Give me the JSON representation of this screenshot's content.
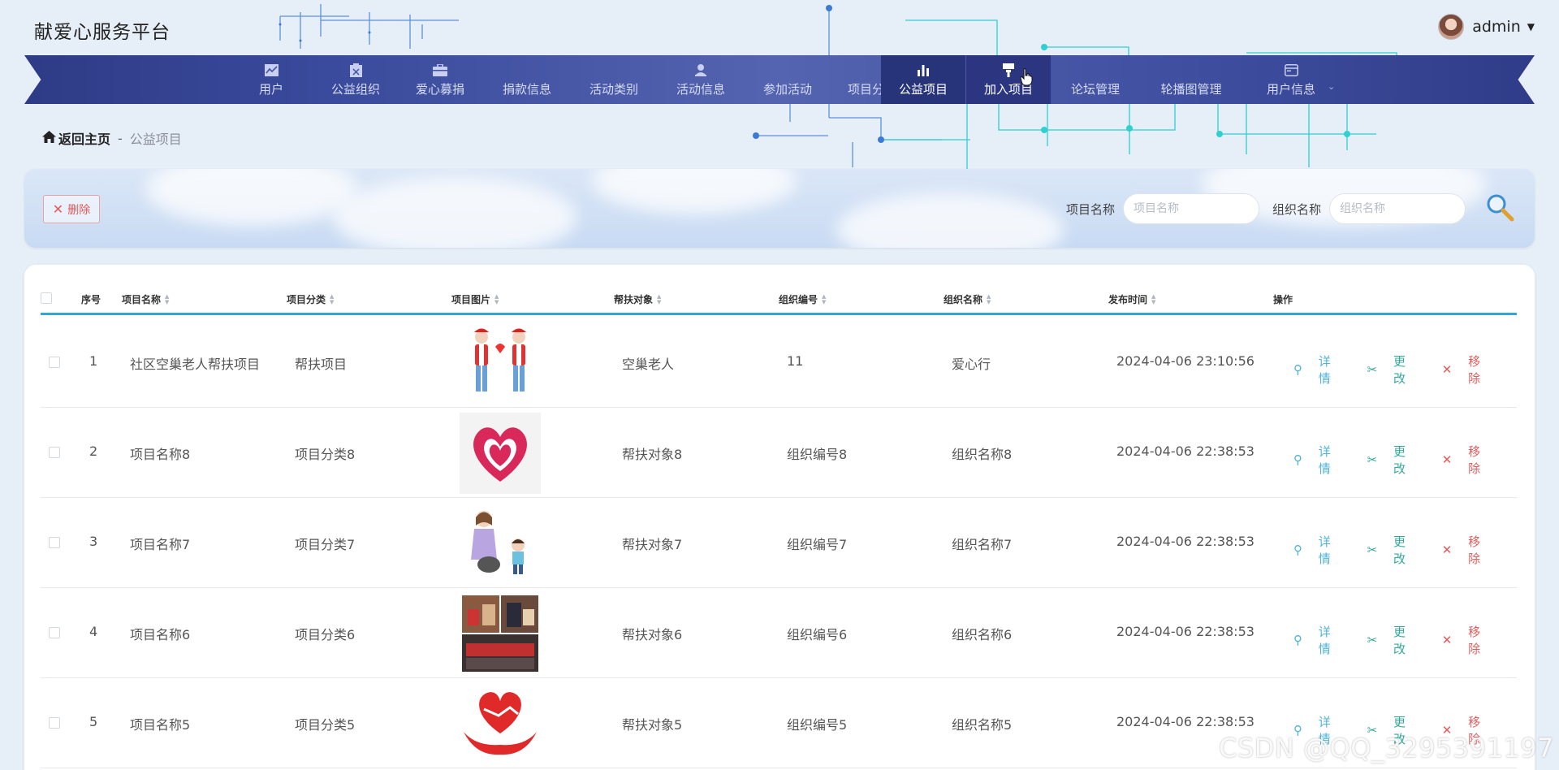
{
  "app": {
    "title": "献爱心服务平台"
  },
  "user": {
    "name": "admin"
  },
  "nav": [
    {
      "label": "用户",
      "icon": "chart-icon"
    },
    {
      "label": "公益组织",
      "icon": "clipboard-icon"
    },
    {
      "label": "爱心募捐",
      "icon": "briefcase-icon"
    },
    {
      "label": "捐款信息",
      "icon": "grid-icon"
    },
    {
      "label": "活动类别",
      "icon": "grid9-icon"
    },
    {
      "label": "活动信息",
      "icon": "person-icon"
    },
    {
      "label": "参加活动",
      "icon": "grid-icon"
    },
    {
      "label": "项目分类",
      "icon": "grid-icon"
    },
    {
      "label": "公益项目",
      "icon": "bar-chart-icon"
    },
    {
      "label": "加入项目",
      "icon": "brush-icon"
    },
    {
      "label": "论坛管理",
      "icon": "grid-icon"
    },
    {
      "label": "轮播图管理",
      "icon": "grid-icon"
    },
    {
      "label": "用户信息",
      "icon": "window-icon"
    }
  ],
  "breadcrumb": {
    "home": "返回主页",
    "sep": "-",
    "current": "公益项目"
  },
  "toolbar": {
    "delete_label": "删除",
    "project_name_label": "项目名称",
    "project_name_placeholder": "项目名称",
    "org_name_label": "组织名称",
    "org_name_placeholder": "组织名称"
  },
  "table": {
    "headers": {
      "index": "序号",
      "name": "项目名称",
      "category": "项目分类",
      "image": "项目图片",
      "target": "帮扶对象",
      "org_no": "组织编号",
      "org_name": "组织名称",
      "time": "发布时间",
      "ops": "操作"
    },
    "ops": {
      "detail": "详情",
      "edit": "更改",
      "remove": "移除"
    },
    "rows": [
      {
        "index": "1",
        "name": "社区空巢老人帮扶项目",
        "category": "帮扶项目",
        "target": "空巢老人",
        "org_no": "11",
        "org_name": "爱心行",
        "time": "2024-04-06 23:10:56",
        "image": "volunteers-icon"
      },
      {
        "index": "2",
        "name": "项目名称8",
        "category": "项目分类8",
        "target": "帮扶对象8",
        "org_no": "组织编号8",
        "org_name": "组织名称8",
        "time": "2024-04-06 22:38:53",
        "image": "heart-hands-icon"
      },
      {
        "index": "3",
        "name": "项目名称7",
        "category": "项目分类7",
        "target": "帮扶对象7",
        "org_no": "组织编号7",
        "org_name": "组织名称7",
        "time": "2024-04-06 22:38:53",
        "image": "mother-child-icon"
      },
      {
        "index": "4",
        "name": "项目名称6",
        "category": "项目分类6",
        "target": "帮扶对象6",
        "org_no": "组织编号6",
        "org_name": "组织名称6",
        "time": "2024-04-06 22:38:53",
        "image": "photo-collage-icon"
      },
      {
        "index": "5",
        "name": "项目名称5",
        "category": "项目分类5",
        "target": "帮扶对象5",
        "org_no": "组织编号5",
        "org_name": "组织名称5",
        "time": "2024-04-06 22:38:53",
        "image": "handshake-heart-icon"
      }
    ]
  },
  "watermark": "CSDN @QQ_3295391197",
  "colors": {
    "nav_bg": "#3a4a9c",
    "nav_active": "#28347a",
    "accent": "#2fa8d8",
    "danger": "#e25b5b",
    "edit": "#35a89a"
  }
}
